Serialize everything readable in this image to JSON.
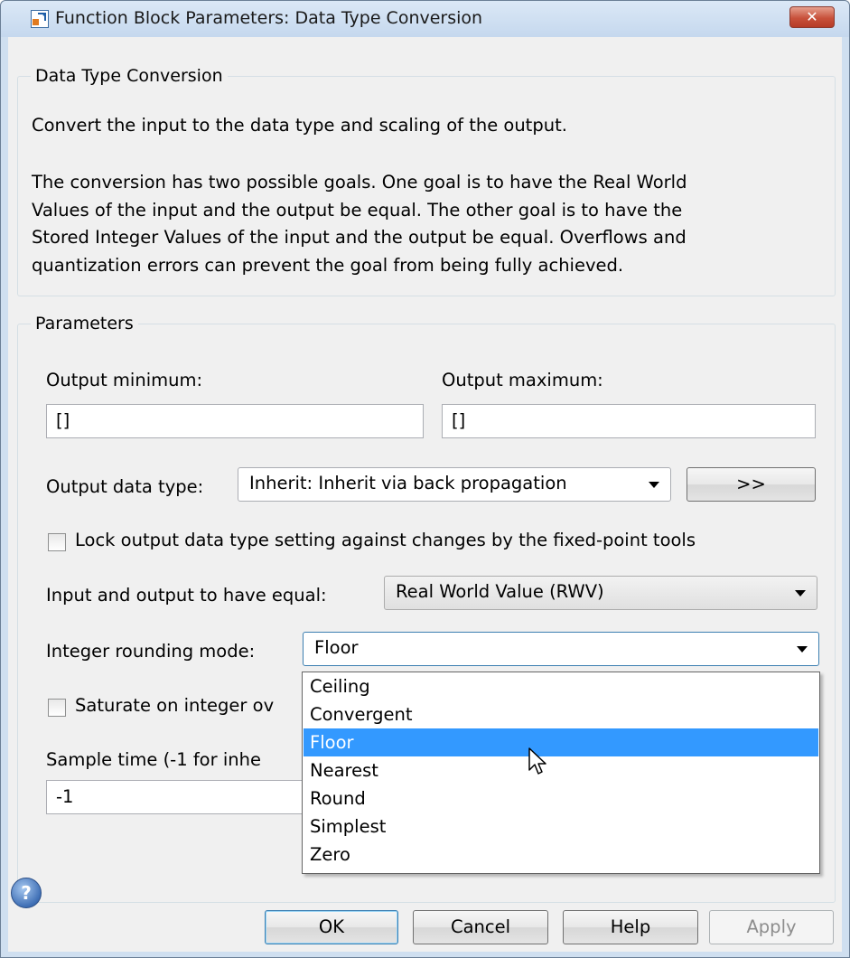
{
  "window": {
    "title": "Function Block Parameters: Data Type Conversion",
    "close_label": "✕"
  },
  "description": {
    "legend": "Data Type Conversion",
    "line1": "Convert the input to the data type and scaling of the output.",
    "para_lines": [
      "The conversion has two possible goals. One goal is to have the Real World",
      "Values of the input and the output be equal.  The other goal is to have the",
      "Stored Integer Values of the input and the output be equal.  Overflows and",
      "quantization errors can prevent the goal from being fully achieved."
    ]
  },
  "parameters": {
    "legend": "Parameters",
    "output_minimum_label": "Output minimum:",
    "output_minimum_value": "[]",
    "output_maximum_label": "Output maximum:",
    "output_maximum_value": "[]",
    "output_data_type_label": "Output data type:",
    "output_data_type_value": "Inherit: Inherit via back propagation",
    "data_type_assistant_label": ">>",
    "lock_label": "Lock output data type setting against changes by the fixed-point tools",
    "lock_checked": false,
    "equal_label": "Input and output to have equal:",
    "equal_value": "Real World Value (RWV)",
    "rounding_label": "Integer rounding mode:",
    "rounding_value": "Floor",
    "saturate_label": "Saturate on integer ov",
    "saturate_checked": false,
    "sample_time_label": "Sample time (-1 for inhe",
    "sample_time_value": "-1"
  },
  "rounding_options": [
    "Ceiling",
    "Convergent",
    "Floor",
    "Nearest",
    "Round",
    "Simplest",
    "Zero"
  ],
  "rounding_selected_index": 2,
  "buttons": {
    "ok": "OK",
    "cancel": "Cancel",
    "help": "Help",
    "apply": "Apply"
  },
  "icons": {
    "app": "simulink-block-icon",
    "help": "help-question-icon",
    "close": "close-icon",
    "cursor": "mouse-pointer-icon"
  },
  "colors": {
    "selection": "#3399ff",
    "close_button": "#c8513b",
    "title_bar": "#cfdff0"
  }
}
